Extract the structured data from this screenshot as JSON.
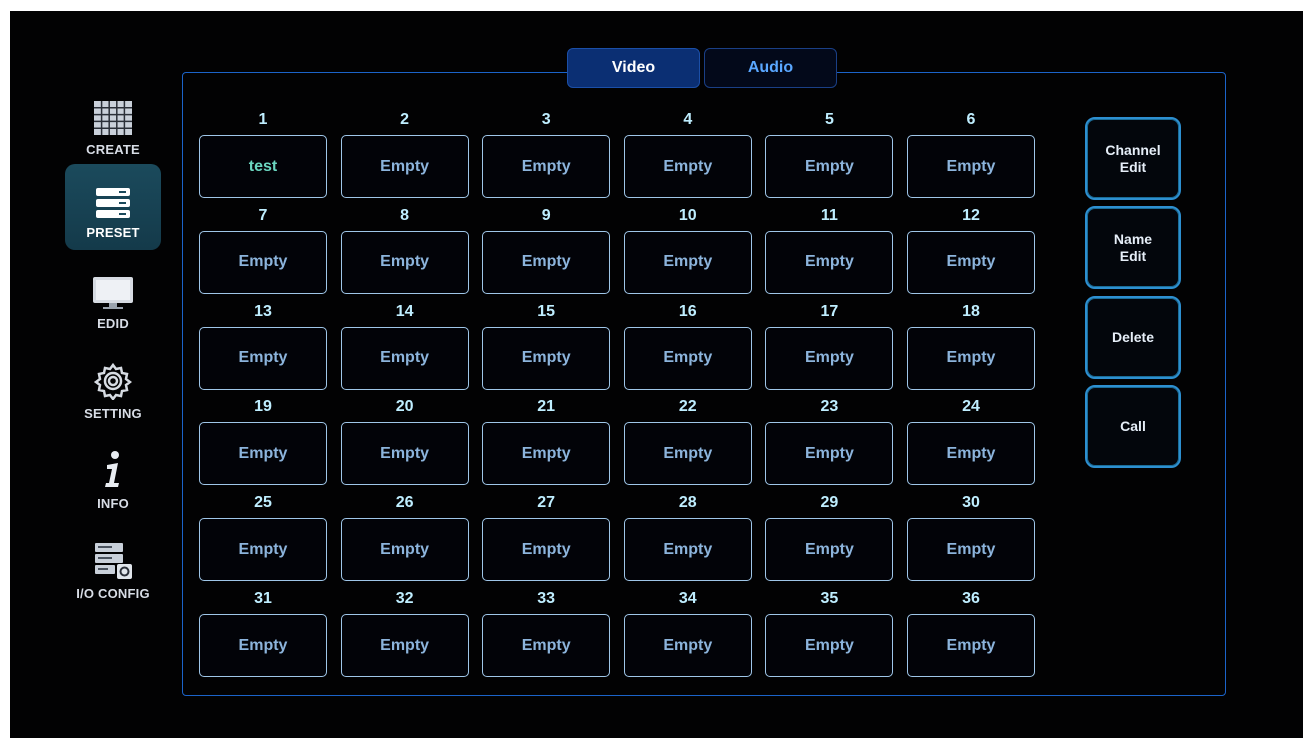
{
  "sidebar": {
    "items": [
      {
        "label": "CREATE",
        "icon": "grid-icon",
        "active": false
      },
      {
        "label": "PRESET",
        "icon": "preset-icon",
        "active": true
      },
      {
        "label": "EDID",
        "icon": "monitor-icon",
        "active": false
      },
      {
        "label": "SETTING",
        "icon": "gear-icon",
        "active": false
      },
      {
        "label": "INFO",
        "icon": "info-icon",
        "active": false
      },
      {
        "label": "I/O CONFIG",
        "icon": "io-config-icon",
        "active": false
      }
    ]
  },
  "tabs": [
    {
      "label": "Video",
      "active": true
    },
    {
      "label": "Audio",
      "active": false
    }
  ],
  "presets": [
    {
      "num": "1",
      "name": "test"
    },
    {
      "num": "2",
      "name": "Empty"
    },
    {
      "num": "3",
      "name": "Empty"
    },
    {
      "num": "4",
      "name": "Empty"
    },
    {
      "num": "5",
      "name": "Empty"
    },
    {
      "num": "6",
      "name": "Empty"
    },
    {
      "num": "7",
      "name": "Empty"
    },
    {
      "num": "8",
      "name": "Empty"
    },
    {
      "num": "9",
      "name": "Empty"
    },
    {
      "num": "10",
      "name": "Empty"
    },
    {
      "num": "11",
      "name": "Empty"
    },
    {
      "num": "12",
      "name": "Empty"
    },
    {
      "num": "13",
      "name": "Empty"
    },
    {
      "num": "14",
      "name": "Empty"
    },
    {
      "num": "15",
      "name": "Empty"
    },
    {
      "num": "16",
      "name": "Empty"
    },
    {
      "num": "17",
      "name": "Empty"
    },
    {
      "num": "18",
      "name": "Empty"
    },
    {
      "num": "19",
      "name": "Empty"
    },
    {
      "num": "20",
      "name": "Empty"
    },
    {
      "num": "21",
      "name": "Empty"
    },
    {
      "num": "22",
      "name": "Empty"
    },
    {
      "num": "23",
      "name": "Empty"
    },
    {
      "num": "24",
      "name": "Empty"
    },
    {
      "num": "25",
      "name": "Empty"
    },
    {
      "num": "26",
      "name": "Empty"
    },
    {
      "num": "27",
      "name": "Empty"
    },
    {
      "num": "28",
      "name": "Empty"
    },
    {
      "num": "29",
      "name": "Empty"
    },
    {
      "num": "30",
      "name": "Empty"
    },
    {
      "num": "31",
      "name": "Empty"
    },
    {
      "num": "32",
      "name": "Empty"
    },
    {
      "num": "33",
      "name": "Empty"
    },
    {
      "num": "34",
      "name": "Empty"
    },
    {
      "num": "35",
      "name": "Empty"
    },
    {
      "num": "36",
      "name": "Empty"
    }
  ],
  "actions": [
    {
      "label": "Channel\nEdit",
      "name": "channel-edit-button"
    },
    {
      "label": "Name\nEdit",
      "name": "name-edit-button"
    },
    {
      "label": "Delete",
      "name": "delete-button"
    },
    {
      "label": "Call",
      "name": "call-button"
    }
  ],
  "colors": {
    "panel_border": "#1b63c9",
    "active_tab": "#0b2f73",
    "active_sidebar": "#1b4a5c",
    "preset_named_text": "#6bd6c0",
    "preset_empty_text": "#8cb4dc"
  }
}
